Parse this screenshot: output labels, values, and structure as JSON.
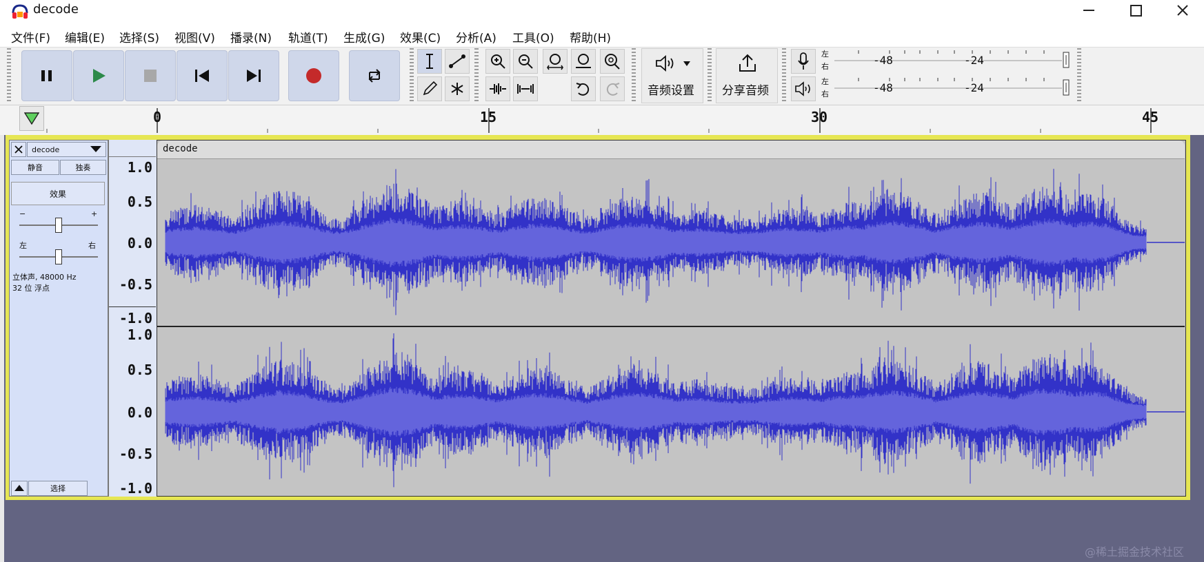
{
  "window": {
    "title": "decode",
    "minimize_icon": "minimize-icon",
    "maximize_icon": "maximize-icon",
    "close_icon": "close-icon"
  },
  "menu": [
    "文件(F)",
    "编辑(E)",
    "选择(S)",
    "视图(V)",
    "播录(N)",
    "轨道(T)",
    "生成(G)",
    "效果(C)",
    "分析(A)",
    "工具(O)",
    "帮助(H)"
  ],
  "toolbar": {
    "audio_setup_label": "音频设置",
    "share_audio_label": "分享音频",
    "meter": {
      "record_left": "左",
      "record_right": "右",
      "play_left": "左",
      "play_right": "右",
      "ticks": [
        "-48",
        "-24"
      ]
    }
  },
  "ruler": {
    "labels": [
      "0",
      "15",
      "30",
      "45"
    ]
  },
  "track": {
    "name": "decode",
    "mute_label": "静音",
    "solo_label": "独奏",
    "effects_label": "效果",
    "gain_minus": "−",
    "gain_plus": "+",
    "pan_left": "左",
    "pan_right": "右",
    "info_line1": "立体声, 48000 Hz",
    "info_line2": "32 位 浮点",
    "select_label": "选择",
    "clip_name": "decode",
    "scale_top": [
      "1.0",
      "0.5",
      "0.0",
      "-0.5",
      "-1.0"
    ],
    "scale_bottom": [
      "1.0",
      "0.5",
      "0.0",
      "-0.5",
      "-1.0"
    ]
  },
  "colors": {
    "waveform": "#3232c8",
    "waveform_rms": "#6464dc",
    "clip_bg": "#c4c4c4",
    "track_frame": "#e6e653",
    "background": "#636482"
  },
  "watermark": "@稀土掘金技术社区"
}
